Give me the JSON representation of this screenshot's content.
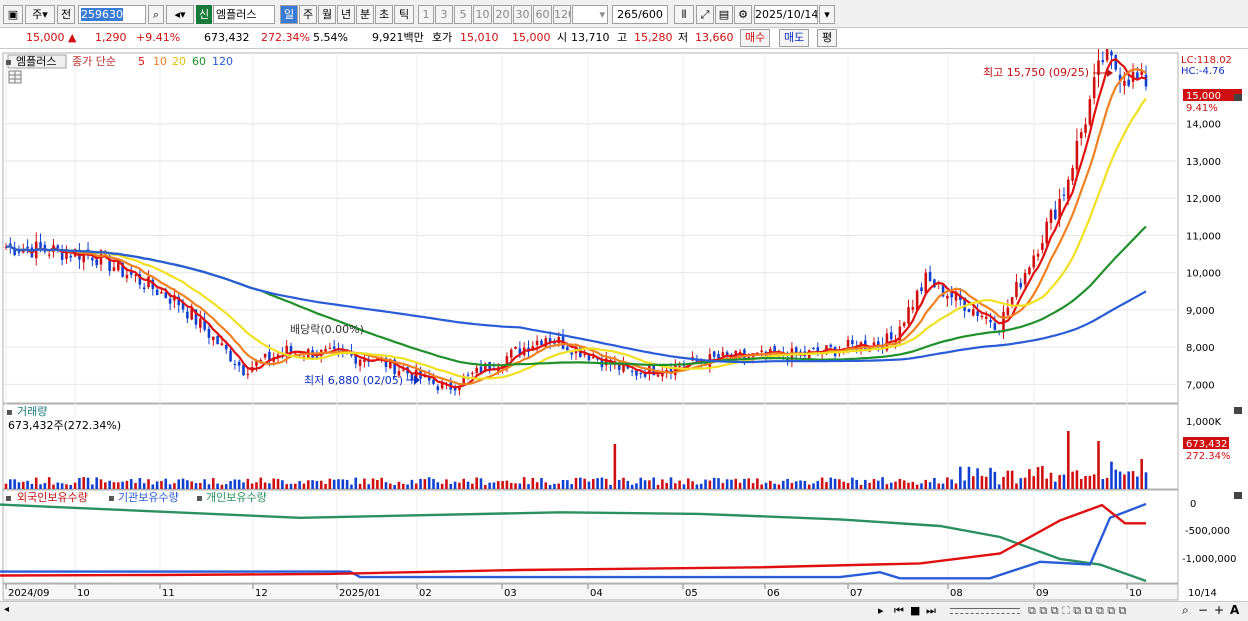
{
  "toolbar": {
    "code_type": "주",
    "prev_label": "전",
    "stock_code": "259630",
    "credit_badge": "신",
    "stock_name": "엠플러스",
    "periods": [
      "일",
      "주",
      "월",
      "년",
      "분",
      "초",
      "틱"
    ],
    "active_period": "일",
    "intervals": [
      "1",
      "3",
      "5",
      "10",
      "20",
      "30",
      "60",
      "120"
    ],
    "count": "265",
    "count_max": "/600",
    "date": "2025/10/14"
  },
  "quote": {
    "price": "15,000",
    "arrow": "▲",
    "change": "1,290",
    "change_pct": "+9.41%",
    "volume": "673,432",
    "volume_ratio": "272.34%",
    "turnover": "5.54%",
    "amount": "9,921백만",
    "bid_label": "호가",
    "bid": "15,010",
    "ask": "15,000",
    "open_label": "시",
    "open": "13,710",
    "high_label": "고",
    "high": "15,280",
    "low_label": "저",
    "low": "13,660",
    "buy_label": "매수",
    "sell_label": "매도",
    "eval_label": "평"
  },
  "price_panel": {
    "name": "엠플러스",
    "legend_prefix": "종가 단순",
    "ma": [
      {
        "period": "5",
        "color": "#e01010"
      },
      {
        "period": "10",
        "color": "#f08020"
      },
      {
        "period": "20",
        "color": "#f0e020"
      },
      {
        "period": "60",
        "color": "#20902a"
      },
      {
        "period": "120",
        "color": "#2a5cd8"
      }
    ],
    "lc": "LC:118.02",
    "hc": "HC:-4.76",
    "last_price": "15,000",
    "last_pct": "9.41%",
    "y_ticks": [
      "14,000",
      "13,000",
      "12,000",
      "11,000",
      "10,000",
      "9,000",
      "8,000",
      "7,000"
    ],
    "high_annot": "최고 15,750 (09/25)",
    "low_annot": "최저 6,880 (02/05)",
    "dividend_annot": "배당락(0.00%)"
  },
  "volume_panel": {
    "title": "거래량",
    "info": "673,432주(272.34%)",
    "y_tick": "1,000K",
    "last": "673,432",
    "last_pct": "272.34%"
  },
  "holder_panel": {
    "series": [
      {
        "name": "외국인보유수량",
        "color": "#e01010"
      },
      {
        "name": "기관보유수량",
        "color": "#2a5cd8"
      },
      {
        "name": "개인보유수량",
        "color": "#2a9060"
      }
    ],
    "y_ticks": [
      "0",
      "-500,000",
      "-1,000,000"
    ]
  },
  "x_axis": [
    "2024/09",
    "10",
    "11",
    "12",
    "2025/01",
    "02",
    "03",
    "04",
    "05",
    "06",
    "07",
    "08",
    "09",
    "10"
  ],
  "x_axis_right": "10/14",
  "chart_data": {
    "type": "candlestick",
    "anchors": [
      {
        "date": "2024/09",
        "close": 10700
      },
      {
        "date": "2024/10",
        "close": 10500
      },
      {
        "date": "2024/11",
        "close": 9200
      },
      {
        "date": "2024/11 mid",
        "close": 7400
      },
      {
        "date": "2024/12",
        "close": 7900
      },
      {
        "date": "2025/01",
        "close": 7700
      },
      {
        "date": "2025/02",
        "close": 6880
      },
      {
        "date": "2025/03",
        "close": 8300
      },
      {
        "date": "2025/04",
        "close": 7300
      },
      {
        "date": "2025/05",
        "close": 7700
      },
      {
        "date": "2025/06",
        "close": 7800
      },
      {
        "date": "2025/07",
        "close": 8200
      },
      {
        "date": "2025/07 end",
        "close": 9800
      },
      {
        "date": "2025/08",
        "close": 8600
      },
      {
        "date": "2025/09",
        "close": 12200
      },
      {
        "date": "2025/09/25",
        "close": 15750
      },
      {
        "date": "2025/10/14",
        "close": 15000
      }
    ],
    "ylim": [
      6500,
      15900
    ]
  }
}
